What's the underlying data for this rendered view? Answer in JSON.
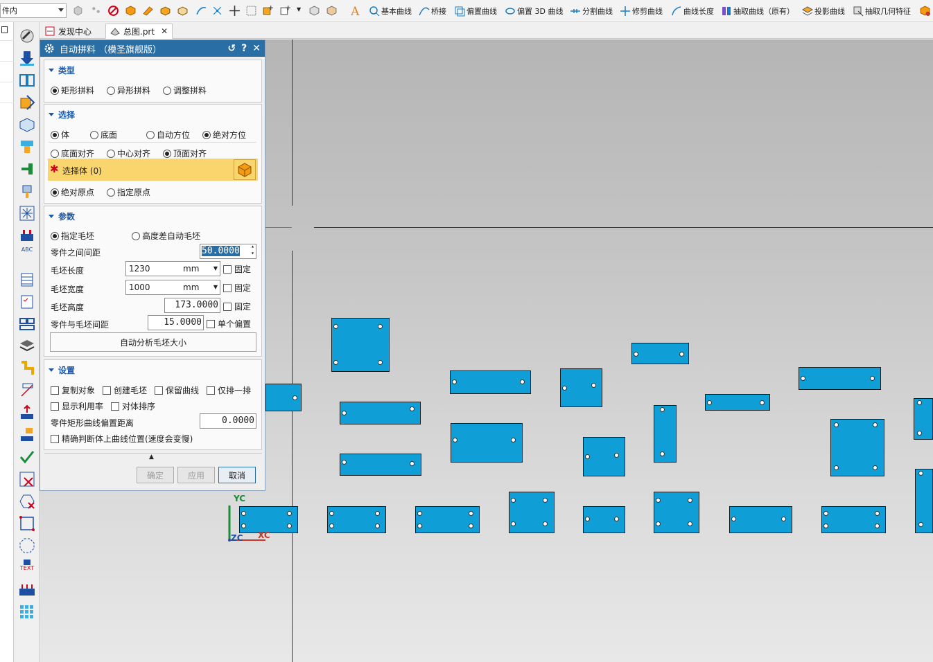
{
  "toolbar": {
    "filter_value": "件内",
    "buttons": [
      {
        "label": "基本曲线",
        "icon": "basic-curve-icon"
      },
      {
        "label": "桥接",
        "icon": "bridge-curve-icon"
      },
      {
        "label": "偏置曲线",
        "icon": "offset-curve-icon"
      },
      {
        "label": "偏置 3D 曲线",
        "icon": "offset-3d-curve-icon"
      },
      {
        "label": "分割曲线",
        "icon": "divide-curve-icon"
      },
      {
        "label": "修剪曲线",
        "icon": "trim-curve-icon"
      },
      {
        "label": "曲线长度",
        "icon": "curve-length-icon"
      },
      {
        "label": "抽取曲线（原有）",
        "icon": "extract-curve-icon"
      },
      {
        "label": "投影曲线",
        "icon": "project-curve-icon"
      },
      {
        "label": "抽取几何特征",
        "icon": "extract-geometry-icon"
      }
    ]
  },
  "tabs": [
    {
      "label": "发现中心",
      "icon": "discovery-center-icon",
      "active": false
    },
    {
      "label": "总图.prt",
      "icon": "part-file-icon",
      "active": true
    }
  ],
  "dialog": {
    "title": "自动拼料 （模圣旗舰版）",
    "type_group": {
      "header": "类型",
      "options": [
        "矩形拼料",
        "异形拼料",
        "调整拼料"
      ],
      "selected": "矩形拼料"
    },
    "select_group": {
      "header": "选择",
      "row1": [
        "体",
        "底面",
        "自动方位",
        "绝对方位"
      ],
      "row1_selected": [
        "体",
        "绝对方位"
      ],
      "row2": [
        "底面对齐",
        "中心对齐",
        "顶面对齐"
      ],
      "row2_selected": "顶面对齐",
      "select_body_label": "选择体 (0)",
      "row3": [
        "绝对原点",
        "指定原点"
      ],
      "row3_selected": "绝对原点"
    },
    "params_group": {
      "header": "参数",
      "options": [
        "指定毛坯",
        "高度差自动毛坯"
      ],
      "selected": "指定毛坯",
      "part_spacing_label": "零件之间间距",
      "part_spacing_value": "50.0000",
      "blank_length_label": "毛坯长度",
      "blank_length_value": "1230",
      "blank_width_label": "毛坯宽度",
      "blank_width_value": "1000",
      "blank_height_label": "毛坯高度",
      "blank_height_value": "173.0000",
      "part_blank_gap_label": "零件与毛坯间距",
      "part_blank_gap_value": "15.0000",
      "unit": "mm",
      "fixed_label": "固定",
      "single_offset_label": "单个偏置",
      "auto_analyze_button": "自动分析毛坯大小"
    },
    "settings_group": {
      "header": "设置",
      "checks": [
        "复制对象",
        "创建毛坯",
        "保留曲线",
        "仅排一排",
        "显示利用率",
        "对体排序"
      ],
      "offset_label": "零件矩形曲线偏置距离",
      "offset_value": "0.0000",
      "precise_label": "精确判断体上曲线位置(速度会变慢)"
    },
    "buttons": {
      "ok": "确定",
      "apply": "应用",
      "cancel": "取消"
    }
  },
  "canvas": {
    "axis": {
      "y": "YC",
      "z": "ZC",
      "x": "XC"
    },
    "part_color": "#0f9fd6",
    "background_top": "#b5b5b5",
    "background_bottom": "#e8e8e8"
  },
  "sidebar_icons": [
    "wrench-icon",
    "download-arrow-icon",
    "mold-base-icon",
    "insert-icon",
    "box-3d-icon",
    "paint-icon",
    "t-shape-icon",
    "spray-icon",
    "snowflake-icon",
    "plug-icon",
    "abc-rename-icon",
    "table-list-icon",
    "checklist-icon",
    "stack-icon",
    "layers-icon",
    "step-icon",
    "measure-icon",
    "push-icon",
    "person-icon",
    "check-icon",
    "box-x-icon",
    "hexagon-x-icon",
    "square-dashed-icon",
    "octagon-icon",
    "text-icon",
    "multi-plug-icon",
    "grid-icon"
  ],
  "sidebar_text_label": "TEXT",
  "sidebar_abc_label": "ABC"
}
